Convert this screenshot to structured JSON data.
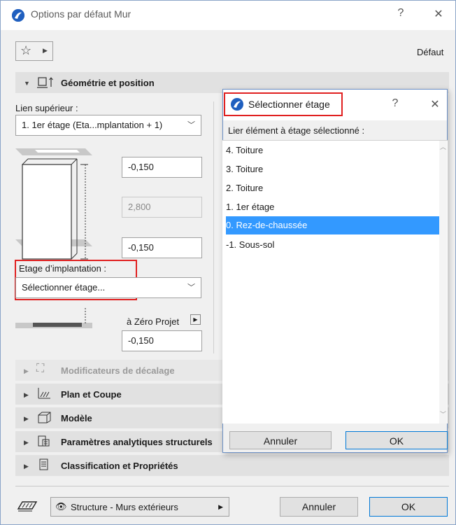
{
  "window": {
    "title": "Options par défaut Mur",
    "help": "?",
    "close": "✕",
    "default_label": "Défaut"
  },
  "section_geometry": {
    "label": "Géométrie et position",
    "top_link_label": "Lien supérieur :",
    "top_link_value": "1. 1er étage (Eta...mplantation + 1)",
    "top_offset": "-0,150",
    "height": "2,800",
    "bottom_offset": "-0,150",
    "home_story_label": "Etage d’implantation :",
    "home_story_value": "Sélectionner étage...",
    "ref_label": "à Zéro Projet",
    "ref_value": "-0,150"
  },
  "sections": [
    {
      "label": "Modificateurs de décalage",
      "icon": "offset-modifier-icon",
      "disabled": true
    },
    {
      "label": "Plan et Coupe",
      "icon": "plan-section-icon",
      "disabled": false
    },
    {
      "label": "Modèle",
      "icon": "model-icon",
      "disabled": false
    },
    {
      "label": "Paramètres analytiques structurels",
      "icon": "structural-icon",
      "disabled": false
    },
    {
      "label": "Classification et Propriétés",
      "icon": "classification-icon",
      "disabled": false
    }
  ],
  "footer": {
    "layer": "Structure - Murs extérieurs",
    "cancel": "Annuler",
    "ok": "OK"
  },
  "dialog": {
    "title": "Sélectionner étage",
    "help": "?",
    "close": "✕",
    "prompt": "Lier élément à étage sélectionné :",
    "items": [
      "4. Toiture",
      "3. Toiture",
      "2. Toiture",
      "1. 1er étage",
      "0. Rez-de-chaussée",
      "-1. Sous-sol"
    ],
    "selected_index": 4,
    "cancel": "Annuler",
    "ok": "OK"
  },
  "colors": {
    "selection": "#3399ff",
    "highlight_frame": "#e02020",
    "accent": "#0078d7"
  }
}
